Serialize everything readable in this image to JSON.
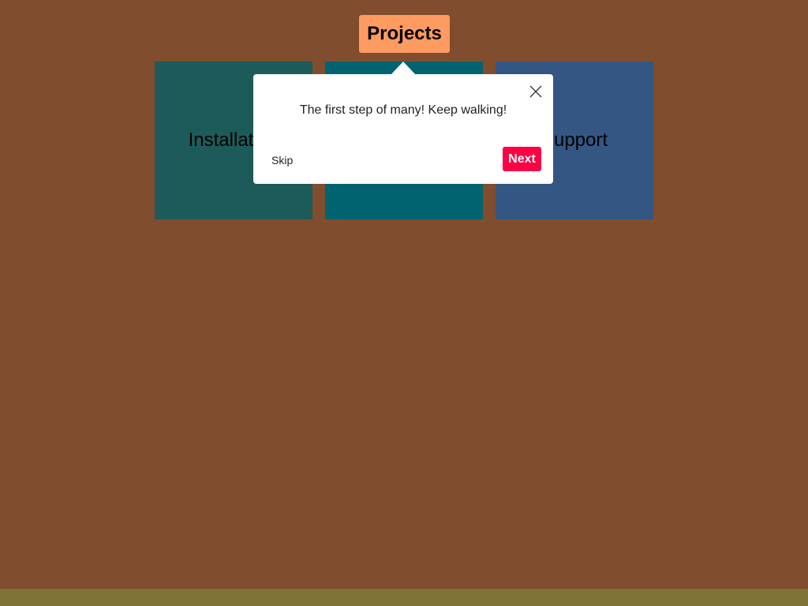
{
  "header": {
    "projects_label": "Projects"
  },
  "tiles": [
    {
      "label": "Installation"
    },
    {
      "label": ""
    },
    {
      "label": "Support"
    }
  ],
  "tour_popover": {
    "message": "The first step of many! Keep walking!",
    "skip_label": "Skip",
    "next_label": "Next",
    "close_icon": "close-icon"
  },
  "colors": {
    "page_background": "#804d2e",
    "projects_button": "#fe9b60",
    "tile_1": "#1c5b5a",
    "tile_2": "#01636f",
    "tile_3": "#335683",
    "next_button": "#ff0044",
    "footer_bar": "#7f7436"
  }
}
